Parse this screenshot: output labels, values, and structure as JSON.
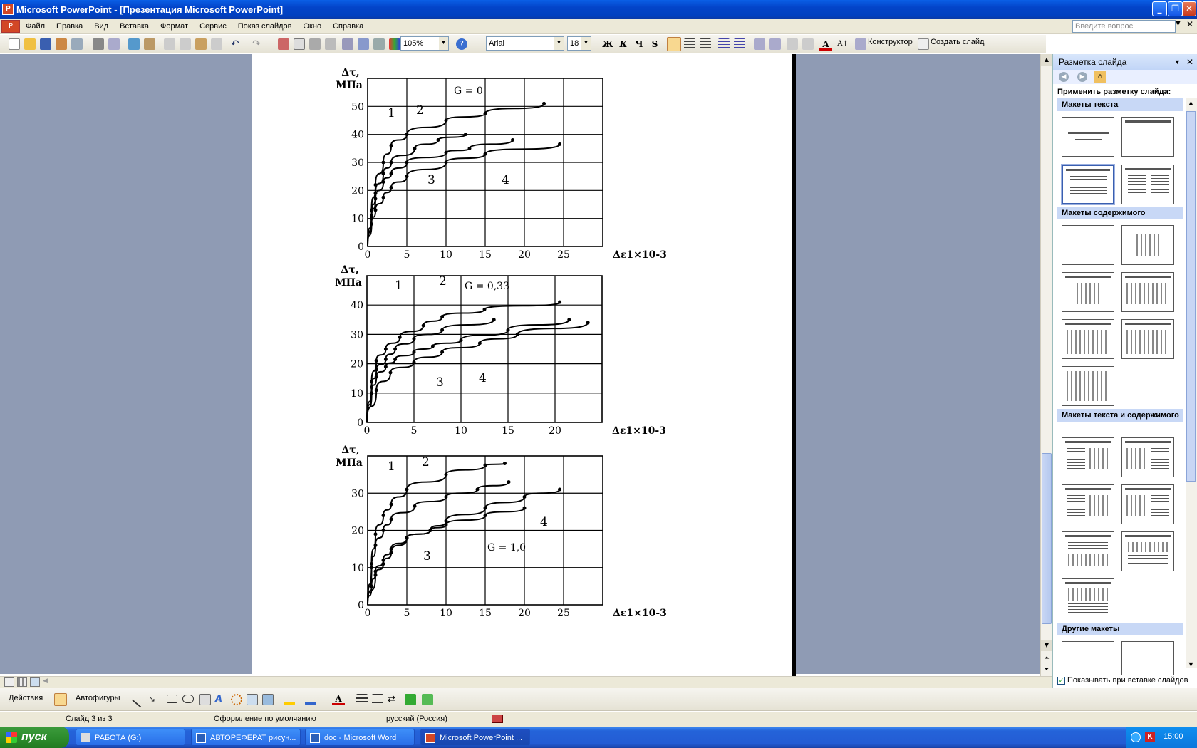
{
  "titlebar": {
    "title": "Microsoft PowerPoint - [Презентация Microsoft PowerPoint]"
  },
  "menu": [
    "Файл",
    "Правка",
    "Вид",
    "Вставка",
    "Формат",
    "Сервис",
    "Показ слайдов",
    "Окно",
    "Справка"
  ],
  "askbox": {
    "placeholder": "Введите вопрос"
  },
  "toolbar": {
    "zoom": "105%",
    "font": "Arial",
    "font_size": "18",
    "bold": "Ж",
    "italic": "К",
    "underline": "Ч",
    "shadow": "S",
    "designer": "Конструктор",
    "new_slide": "Создать слайд"
  },
  "taskpane": {
    "title": "Разметка слайда",
    "apply_label": "Применить разметку слайда:",
    "sections": {
      "text": "Макеты текста",
      "content": "Макеты содержимого",
      "text_content": "Макеты текста и содержимого",
      "other": "Другие макеты"
    },
    "show_on_insert": "Показывать при вставке слайдов"
  },
  "drawbar": {
    "actions": "Действия",
    "autoshapes": "Автофигуры"
  },
  "status": {
    "slide": "Слайд 3 из 3",
    "design": "Оформление по умолчанию",
    "lang": "русский (Россия)"
  },
  "taskbar": {
    "start": "пуск",
    "tasks": [
      "РАБОТА (G:)",
      "АВТОРЕФЕРАТ рисун...",
      "doc - Microsoft Word",
      "Microsoft PowerPoint ..."
    ],
    "lang": "EN",
    "time": "15:00"
  },
  "chart_data": [
    {
      "type": "line",
      "title": "G = 0",
      "ylabel": "Δτ, МПа",
      "xlabel": "Δε1×10-3",
      "xlim": [
        0,
        30
      ],
      "ylim": [
        0,
        60
      ],
      "xticks": [
        0,
        5,
        10,
        15,
        20,
        25
      ],
      "yticks": [
        0,
        10,
        20,
        30,
        40,
        50
      ],
      "series": [
        {
          "name": "1",
          "x": [
            0,
            0.5,
            1,
            2,
            3,
            5,
            10,
            15,
            22.5
          ],
          "y": [
            0,
            13,
            22,
            30,
            36,
            40,
            45,
            47.5,
            51
          ]
        },
        {
          "name": "2",
          "x": [
            0,
            0.5,
            1,
            2,
            3,
            6,
            9,
            12.5
          ],
          "y": [
            0,
            11,
            19,
            26,
            30,
            35,
            38,
            40
          ]
        },
        {
          "name": "3",
          "x": [
            0,
            0.5,
            1,
            2,
            3,
            5,
            10,
            13,
            18.5
          ],
          "y": [
            0,
            10,
            17,
            23,
            26,
            30,
            33.5,
            35,
            38
          ]
        },
        {
          "name": "4",
          "x": [
            0,
            0.5,
            1,
            2,
            3,
            5,
            10,
            15,
            24.5
          ],
          "y": [
            0,
            8,
            13,
            17.5,
            21,
            25,
            30,
            33,
            36.5
          ]
        }
      ],
      "labels": [
        "1",
        "2",
        "3",
        "4"
      ]
    },
    {
      "type": "line",
      "title": "G = 0,33",
      "ylabel": "Δτ, МПа",
      "xlabel": "Δε1×10-3",
      "xlim": [
        0,
        25
      ],
      "ylim": [
        0,
        50
      ],
      "xticks": [
        0,
        5,
        10,
        15,
        20
      ],
      "yticks": [
        0,
        10,
        20,
        30,
        40
      ],
      "series": [
        {
          "name": "1",
          "x": [
            0,
            0.5,
            1,
            2,
            3.5,
            6,
            8,
            12.5,
            20.5
          ],
          "y": [
            0,
            14,
            21,
            25,
            29,
            33,
            36,
            38.5,
            41
          ]
        },
        {
          "name": "2",
          "x": [
            0,
            0.5,
            1,
            2,
            3,
            5,
            8,
            13.5
          ],
          "y": [
            0,
            12,
            18,
            21.5,
            25,
            28.5,
            31.5,
            35
          ]
        },
        {
          "name": "3",
          "x": [
            0,
            0.5,
            1,
            2,
            3,
            5,
            7,
            10,
            15,
            21.5
          ],
          "y": [
            0,
            10,
            15.5,
            19,
            21.5,
            24,
            26,
            28,
            31.5,
            35
          ]
        },
        {
          "name": "4",
          "x": [
            0,
            1,
            2.5,
            5,
            8,
            12,
            16,
            23.5
          ],
          "y": [
            0,
            11,
            17,
            20.5,
            24,
            27,
            30,
            34
          ]
        }
      ],
      "labels": [
        "1",
        "2",
        "3",
        "4"
      ]
    },
    {
      "type": "line",
      "title": "G = 1,0",
      "ylabel": "Δτ, МПа",
      "xlabel": "Δε1×10-3",
      "xlim": [
        0,
        30
      ],
      "ylim": [
        0,
        40
      ],
      "xticks": [
        0,
        5,
        10,
        15,
        20,
        25
      ],
      "yticks": [
        0,
        10,
        20,
        30
      ],
      "series": [
        {
          "name": "1",
          "x": [
            0,
            0.5,
            1,
            2,
            3,
            5,
            10,
            15,
            17.5
          ],
          "y": [
            0,
            11,
            19,
            24,
            27,
            31,
            35,
            37.5,
            38
          ]
        },
        {
          "name": "2",
          "x": [
            0,
            0.5,
            1,
            2,
            3,
            6,
            10,
            14,
            18
          ],
          "y": [
            0,
            10,
            16,
            20,
            23,
            26.5,
            29,
            31,
            33
          ]
        },
        {
          "name": "3",
          "x": [
            0,
            1,
            2,
            3,
            5,
            8,
            10,
            15,
            20,
            24.5
          ],
          "y": [
            0,
            8,
            11,
            14,
            18,
            20,
            22.5,
            26,
            29,
            31
          ]
        },
        {
          "name": "4",
          "x": [
            0,
            0.5,
            1,
            2,
            3,
            5,
            8,
            10,
            15,
            20
          ],
          "y": [
            0,
            5,
            9,
            12,
            15,
            18,
            20,
            21.5,
            24,
            26
          ]
        }
      ],
      "labels": [
        "1",
        "2",
        "3",
        "4"
      ]
    }
  ]
}
